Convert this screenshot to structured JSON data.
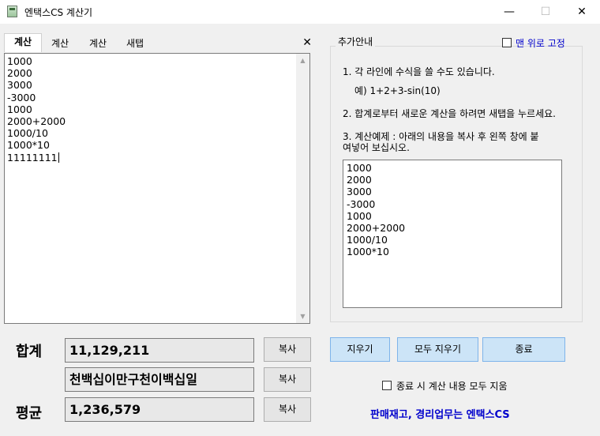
{
  "window": {
    "title": "엔택스CS 계산기",
    "minimize": "—",
    "maximize": "☐",
    "close": "✕"
  },
  "tabs": [
    {
      "label": "계산"
    },
    {
      "label": "계산"
    },
    {
      "label": "계산"
    },
    {
      "label": "새탭"
    }
  ],
  "tab_close": "✕",
  "editor": {
    "lines": [
      "1000",
      "2000",
      "3000",
      "-3000",
      "1000",
      "2000+2000",
      "1000/10",
      "1000*10",
      "11111111"
    ],
    "scroll_up": "▲",
    "scroll_down": "▼"
  },
  "summary": {
    "sum_label": "합계",
    "sum_value": "11,129,211",
    "sum_korean": "천백십이만구천이백십일",
    "avg_label": "평균",
    "avg_value": "1,236,579",
    "copy_label": "복사"
  },
  "guide": {
    "title": "추가안내",
    "always_on_top": "맨 위로 고정",
    "line1": "1. 각 라인에 수식을 쓸 수도 있습니다.",
    "line1_example": "예) 1+2+3-sin(10)",
    "line2": "2. 합계로부터 새로운 계산을 하려면 새탭을 누르세요.",
    "line3a": "3. 계산예제 : 아래의 내용을 복사 후 왼쪽 창에 붙",
    "line3b": "여넣어 보십시오.",
    "example_lines": [
      "1000",
      "2000",
      "3000",
      "-3000",
      "1000",
      "2000+2000",
      "1000/10",
      "1000*10"
    ]
  },
  "actions": {
    "clear": "지우기",
    "clear_all": "모두 지우기",
    "exit": "종료",
    "clear_on_exit": "종료 시 계산 내용 모두 지움"
  },
  "footer": "판매재고, 경리업무는 엔택스CS"
}
